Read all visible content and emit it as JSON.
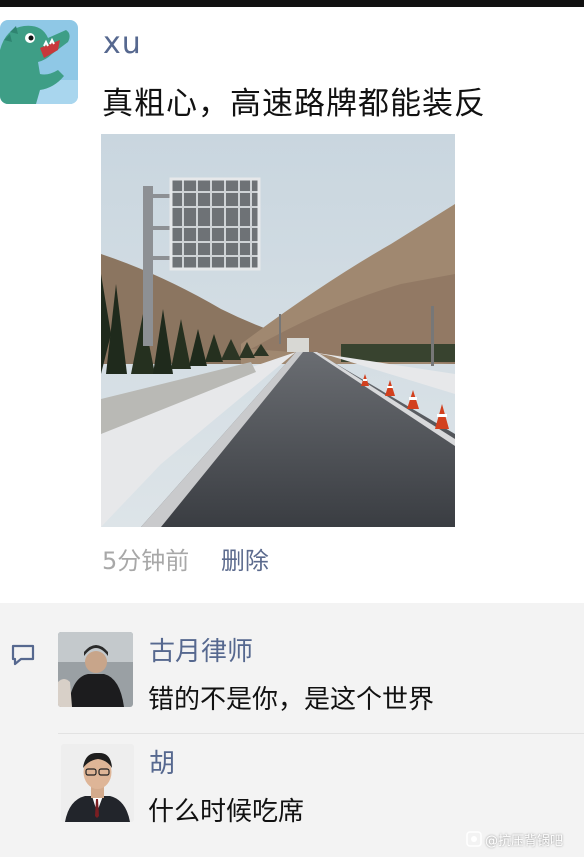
{
  "post": {
    "username": "xu",
    "text": "真粗心，高速路牌都能装反",
    "time": "5分钟前",
    "delete_label": "删除"
  },
  "comments": [
    {
      "name": "古月律师",
      "text": "错的不是你，是这个世界"
    },
    {
      "name": "胡",
      "text": "什么时候吃席"
    }
  ],
  "watermark": "@抗压背锅吧",
  "icons": {
    "comment": "comment-bubble-icon",
    "watermark": "tieba-logo-icon"
  },
  "colors": {
    "name_link": "#56688f",
    "timestamp": "#a8a8a8",
    "comment_area": "#f3f3f3"
  }
}
